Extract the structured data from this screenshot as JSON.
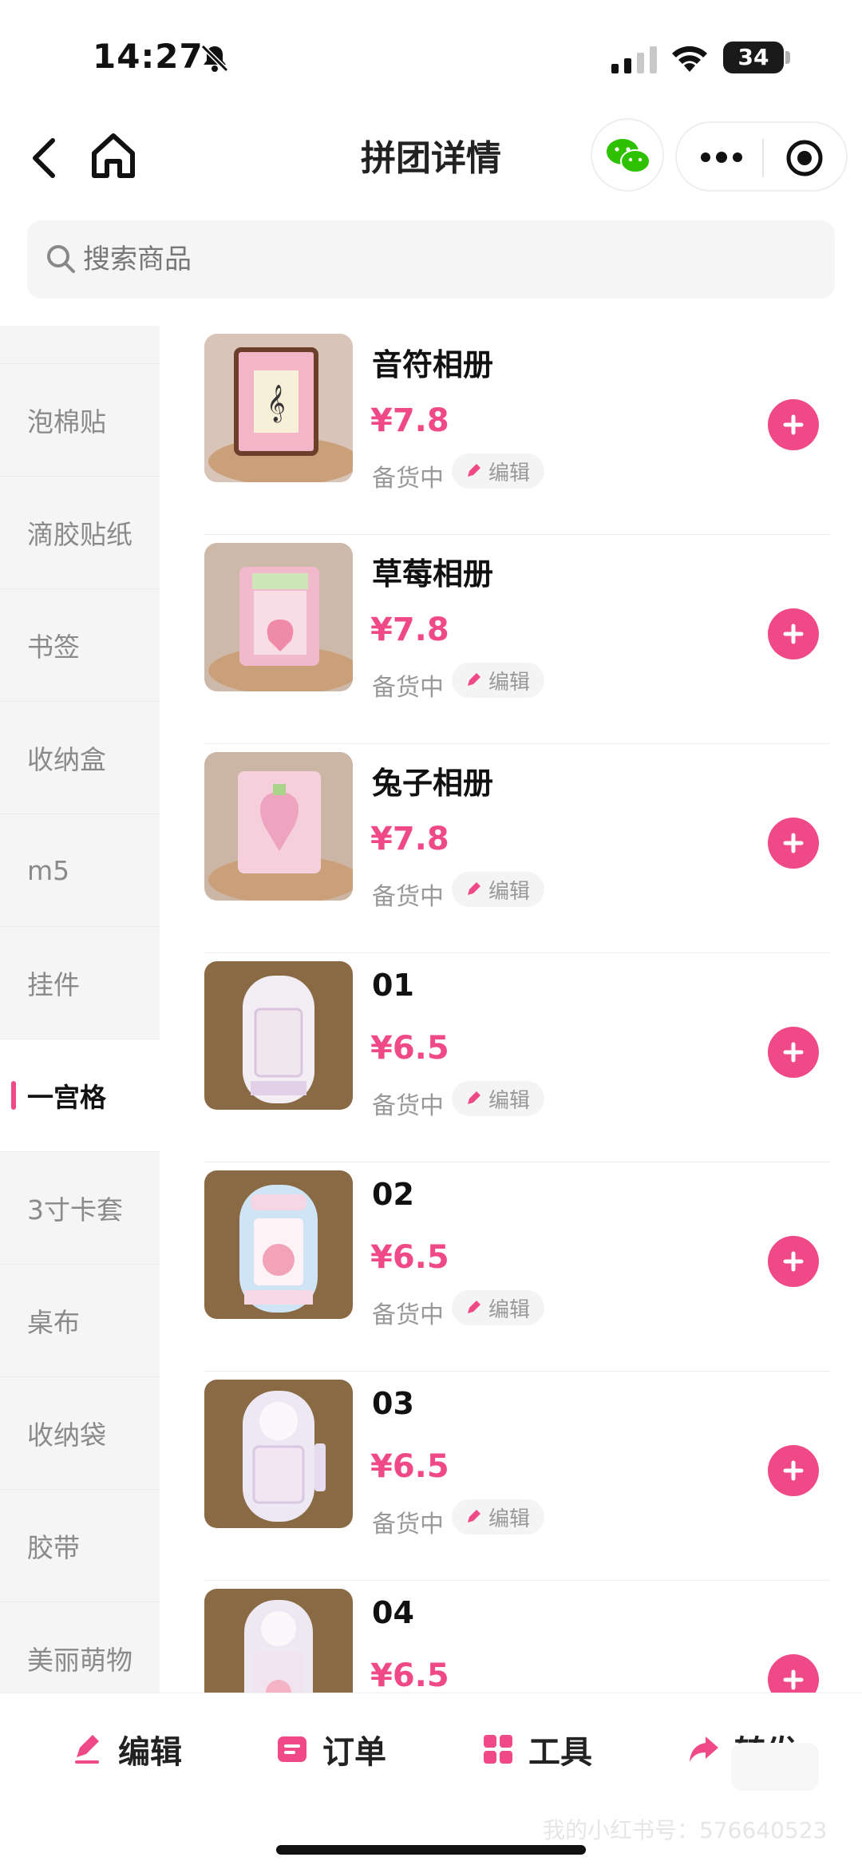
{
  "status_bar": {
    "time": "14:27",
    "battery": "34"
  },
  "nav": {
    "title": "拼团详情"
  },
  "search": {
    "placeholder": "搜索商品"
  },
  "sidebar": {
    "items": [
      {
        "label": "泡棉贴",
        "active": false
      },
      {
        "label": "滴胶贴纸",
        "active": false
      },
      {
        "label": "书签",
        "active": false
      },
      {
        "label": "收纳盒",
        "active": false
      },
      {
        "label": "m5",
        "active": false
      },
      {
        "label": "挂件",
        "active": false
      },
      {
        "label": "一宫格",
        "active": true
      },
      {
        "label": "3寸卡套",
        "active": false
      },
      {
        "label": "桌布",
        "active": false
      },
      {
        "label": "收纳袋",
        "active": false
      },
      {
        "label": "胶带",
        "active": false
      },
      {
        "label": "美丽萌物",
        "active": false
      }
    ]
  },
  "products": [
    {
      "name": "音符相册",
      "price": "¥7.8",
      "status": "备货中",
      "edit_label": "编辑"
    },
    {
      "name": "草莓相册",
      "price": "¥7.8",
      "status": "备货中",
      "edit_label": "编辑"
    },
    {
      "name": "兔子相册",
      "price": "¥7.8",
      "status": "备货中",
      "edit_label": "编辑"
    },
    {
      "name": "01",
      "price": "¥6.5",
      "status": "备货中",
      "edit_label": "编辑"
    },
    {
      "name": "02",
      "price": "¥6.5",
      "status": "备货中",
      "edit_label": "编辑"
    },
    {
      "name": "03",
      "price": "¥6.5",
      "status": "备货中",
      "edit_label": "编辑"
    },
    {
      "name": "04",
      "price": "¥6.5",
      "status": "",
      "edit_label": ""
    }
  ],
  "bottom_tabs": [
    {
      "label": "编辑",
      "icon": "pencil-icon"
    },
    {
      "label": "订单",
      "icon": "order-icon"
    },
    {
      "label": "工具",
      "icon": "grid-icon"
    },
    {
      "label": "转发",
      "icon": "share-icon"
    }
  ],
  "watermark": "我的小红书号：576640523",
  "colors": {
    "accent": "#ef4a87",
    "wechat_green": "#2dc100"
  },
  "icons": [
    "back-icon",
    "home-icon",
    "wechat-icon",
    "more-icon",
    "target-icon",
    "search-icon",
    "plus-icon",
    "pencil-icon"
  ]
}
